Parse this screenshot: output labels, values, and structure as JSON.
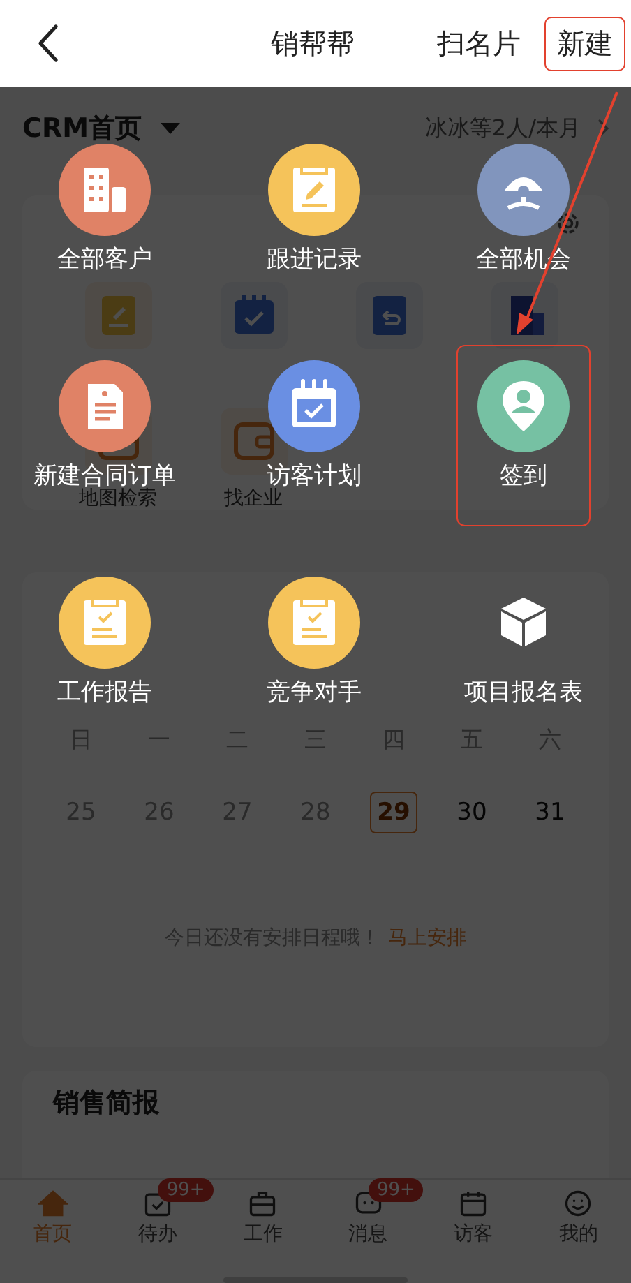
{
  "header": {
    "title": "销帮帮",
    "actions": [
      {
        "label": "扫名片",
        "highlighted": false
      },
      {
        "label": "新建",
        "highlighted": true
      }
    ]
  },
  "dashboard": {
    "title": "CRM首页",
    "filter": "冰冰等2人/本月"
  },
  "forms": {
    "icons": [
      {
        "kind": "note"
      },
      {
        "kind": "calendar"
      },
      {
        "kind": "clipboard"
      },
      {
        "kind": "building"
      }
    ],
    "items": [
      {
        "label": "地图检索",
        "kind": "map"
      },
      {
        "label": "找企业",
        "kind": "wallet"
      }
    ]
  },
  "calendar": {
    "weekdays": [
      "日",
      "一",
      "二",
      "三",
      "四",
      "五",
      "六"
    ],
    "dates": [
      {
        "label": "25",
        "muted": true,
        "selected": false
      },
      {
        "label": "26",
        "muted": true,
        "selected": false
      },
      {
        "label": "27",
        "muted": true,
        "selected": false
      },
      {
        "label": "28",
        "muted": true,
        "selected": false
      },
      {
        "label": "29",
        "muted": false,
        "selected": true
      },
      {
        "label": "30",
        "muted": false,
        "selected": false
      },
      {
        "label": "31",
        "muted": false,
        "selected": false
      }
    ],
    "empty_text": "今日还没有安排日程哦！",
    "empty_link": "马上安排"
  },
  "report": {
    "title": "销售简报"
  },
  "tab_bar": [
    {
      "label": "首页",
      "kind": "home",
      "selected": true
    },
    {
      "label": "待办",
      "kind": "todo",
      "selected": false,
      "badge": "99+"
    },
    {
      "label": "工作",
      "kind": "briefcase",
      "selected": false
    },
    {
      "label": "消息",
      "kind": "chat",
      "selected": false,
      "badge": "99+"
    },
    {
      "label": "访客",
      "kind": "calendar",
      "selected": false
    },
    {
      "label": "我的",
      "kind": "smile",
      "selected": false
    }
  ],
  "menu": [
    {
      "label": "全部客户",
      "kind": "building",
      "color": "#e08266",
      "highlighted": false
    },
    {
      "label": "跟进记录",
      "kind": "note",
      "color": "#f5c35a",
      "highlighted": false
    },
    {
      "label": "全部机会",
      "kind": "umbrella",
      "color": "#8195bd",
      "highlighted": false
    },
    {
      "label": "新建合同订单",
      "kind": "document",
      "color": "#e08266",
      "highlighted": false
    },
    {
      "label": "访客计划",
      "kind": "calendar",
      "color": "#6a8fe3",
      "highlighted": false
    },
    {
      "label": "签到",
      "kind": "pin",
      "color": "#76c1a3",
      "highlighted": true
    },
    {
      "label": "工作报告",
      "kind": "clipboard",
      "color": "#f5c35a",
      "highlighted": false
    },
    {
      "label": "竞争对手",
      "kind": "clipboard",
      "color": "#f5c35a",
      "highlighted": false
    },
    {
      "label": "项目报名表",
      "kind": "cube",
      "highlighted": false
    }
  ]
}
